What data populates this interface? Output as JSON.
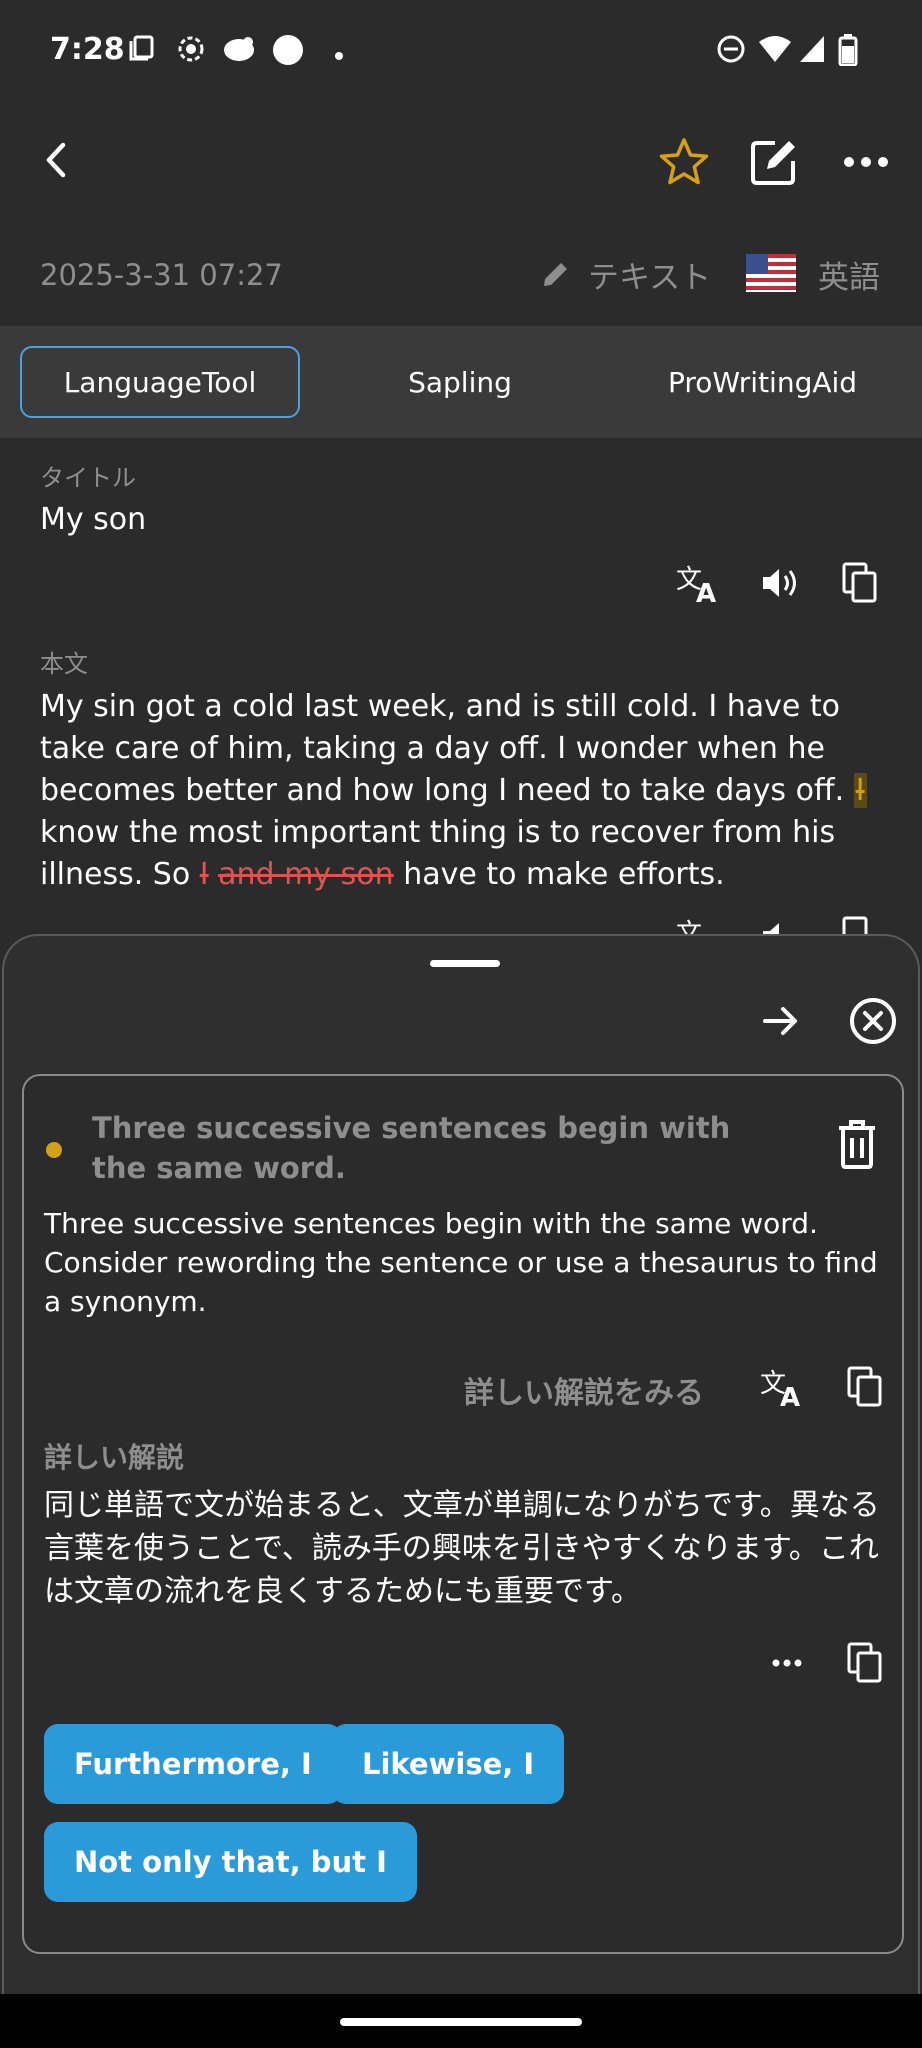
{
  "status_bar": {
    "time": "7:28"
  },
  "entry": {
    "date": "2025-3-31 07:27",
    "type_label": "テキスト",
    "language": "英語"
  },
  "tabs": [
    {
      "label": "LanguageTool",
      "active": true
    },
    {
      "label": "Sapling",
      "active": false
    },
    {
      "label": "ProWritingAid",
      "active": false
    }
  ],
  "title_section": {
    "label": "タイトル",
    "value": "My son"
  },
  "body_section": {
    "label": "本文",
    "text_part1": "My sin got a cold last week, and is still cold. I have to take care of him, taking a day off. I wonder when he becomes better and how long I need to take days off. ",
    "highlight": "I",
    "text_part2": " know the most important thing is to recover from his illness. So ",
    "strike1": "I",
    "strike2": "and my son",
    "text_part3": " have to make efforts."
  },
  "sheet": {
    "card": {
      "headline": "Three successive sentences begin with the same word.",
      "message": "Three successive sentences begin with the same word. Consider rewording the sentence or use a thesaurus to find a synonym.",
      "see_explanation": "詳しい解説をみる",
      "detail_label": "詳しい解説",
      "detail_text": "同じ単語で文が始まると、文章が単調になりがちです。異なる言葉を使うことで、読み手の興味を引きやすくなります。これは文章の流れを良くするためにも重要です。",
      "suggestions": [
        "Furthermore, I",
        "Likewise, I",
        "Not only that, but I"
      ]
    }
  },
  "colors": {
    "background": "#2b2b2b",
    "accent_blue": "#2a9ad8",
    "star_gold": "#d4a017",
    "error_red": "#e05252"
  }
}
